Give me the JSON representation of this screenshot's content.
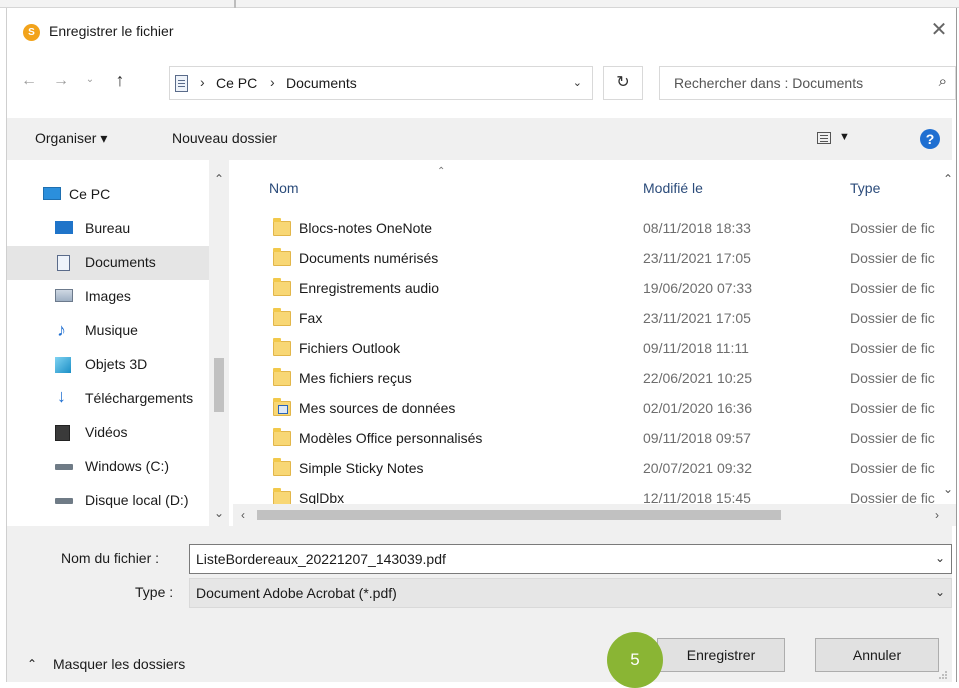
{
  "window": {
    "title": "Enregistrer le fichier",
    "app_icon": "app-logo-icon",
    "close_icon": "close-icon"
  },
  "address_bar": {
    "crumbs": [
      "Ce PC",
      "Documents"
    ],
    "separator": "›",
    "dropdown_icon": "chevron-down-icon",
    "refresh_icon": "refresh-icon"
  },
  "search": {
    "placeholder": "Rechercher dans : Documents",
    "icon": "search-icon"
  },
  "toolbar": {
    "organize": "Organiser ▾",
    "new_folder": "Nouveau dossier",
    "view_icon": "view-options-icon",
    "help_icon": "help-icon",
    "help_label": "?"
  },
  "nav": {
    "items": [
      {
        "label": "Ce PC",
        "icon": "computer-icon",
        "selected": false
      },
      {
        "label": "Bureau",
        "icon": "desktop-icon",
        "selected": false
      },
      {
        "label": "Documents",
        "icon": "documents-icon",
        "selected": true
      },
      {
        "label": "Images",
        "icon": "images-icon",
        "selected": false
      },
      {
        "label": "Musique",
        "icon": "music-icon",
        "selected": false
      },
      {
        "label": "Objets 3D",
        "icon": "3d-objects-icon",
        "selected": false
      },
      {
        "label": "Téléchargements",
        "icon": "downloads-icon",
        "selected": false
      },
      {
        "label": "Vidéos",
        "icon": "videos-icon",
        "selected": false
      },
      {
        "label": "Windows (C:)",
        "icon": "drive-c-icon",
        "selected": false
      },
      {
        "label": "Disque local (D:)",
        "icon": "drive-d-icon",
        "selected": false
      }
    ]
  },
  "files": {
    "columns": {
      "name": "Nom",
      "modified": "Modifié le",
      "type": "Type"
    },
    "rows": [
      {
        "name": "Blocs-notes OneNote",
        "modified": "08/11/2018 18:33",
        "type": "Dossier de fic",
        "icon": "folder-icon"
      },
      {
        "name": "Documents numérisés",
        "modified": "23/11/2021 17:05",
        "type": "Dossier de fic",
        "icon": "folder-icon"
      },
      {
        "name": "Enregistrements audio",
        "modified": "19/06/2020 07:33",
        "type": "Dossier de fic",
        "icon": "folder-icon"
      },
      {
        "name": "Fax",
        "modified": "23/11/2021 17:05",
        "type": "Dossier de fic",
        "icon": "folder-icon"
      },
      {
        "name": "Fichiers Outlook",
        "modified": "09/11/2018 11:11",
        "type": "Dossier de fic",
        "icon": "folder-icon"
      },
      {
        "name": "Mes fichiers reçus",
        "modified": "22/06/2021 10:25",
        "type": "Dossier de fic",
        "icon": "folder-icon"
      },
      {
        "name": "Mes sources de données",
        "modified": "02/01/2020 16:36",
        "type": "Dossier de fic",
        "icon": "data-sources-folder-icon"
      },
      {
        "name": "Modèles Office personnalisés",
        "modified": "09/11/2018 09:57",
        "type": "Dossier de fic",
        "icon": "folder-icon"
      },
      {
        "name": "Simple Sticky Notes",
        "modified": "20/07/2021 09:32",
        "type": "Dossier de fic",
        "icon": "folder-icon"
      },
      {
        "name": "SqlDbx",
        "modified": "12/11/2018 15:45",
        "type": "Dossier de fic",
        "icon": "folder-icon"
      }
    ]
  },
  "save_form": {
    "filename_label": "Nom du fichier :",
    "filename_value": "ListeBordereaux_20221207_143039.pdf",
    "type_label": "Type :",
    "type_value": "Document Adobe Acrobat (*.pdf)"
  },
  "footer": {
    "hide_folders": "Masquer les dossiers",
    "save_button": "Enregistrer",
    "cancel_button": "Annuler",
    "step_badge": "5"
  },
  "colors": {
    "accent_help": "#1f6fd1",
    "folder": "#f8d775",
    "step_badge": "#8ab534",
    "selection": "#e5e5e5"
  }
}
